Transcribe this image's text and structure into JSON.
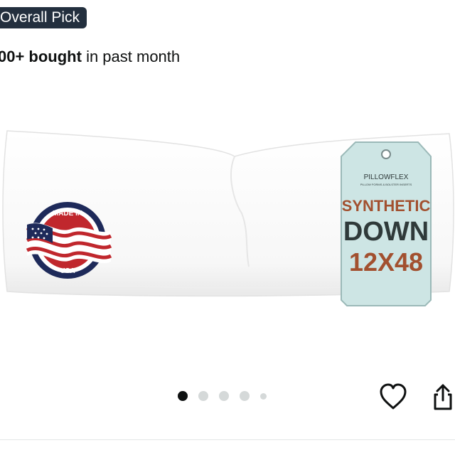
{
  "badge": {
    "label": "Overall Pick"
  },
  "social_proof": {
    "count": "00+ bought",
    "suffix": " in past month"
  },
  "product_image": {
    "tag_brand": "PILLOWFLEX",
    "tag_subtitle": "PILLOW FORMS & BOLSTER INSERTS",
    "tag_line1": "SYNTHETIC",
    "tag_line2": "DOWN",
    "tag_line3": "12X48",
    "seal_top": "MADE IN",
    "seal_bottom": "USA"
  },
  "gallery": {
    "total_dots": 5,
    "active_index": 0
  },
  "icons": {
    "favorite": "heart-icon",
    "share": "share-icon"
  },
  "colors": {
    "badge_bg": "#232f3e",
    "tag_bg": "#cde5e4",
    "tag_text_dark": "#2f3a3a",
    "tag_text_accent": "#a2502f",
    "seal_navy": "#1e2a5a",
    "seal_red": "#c0272d"
  }
}
